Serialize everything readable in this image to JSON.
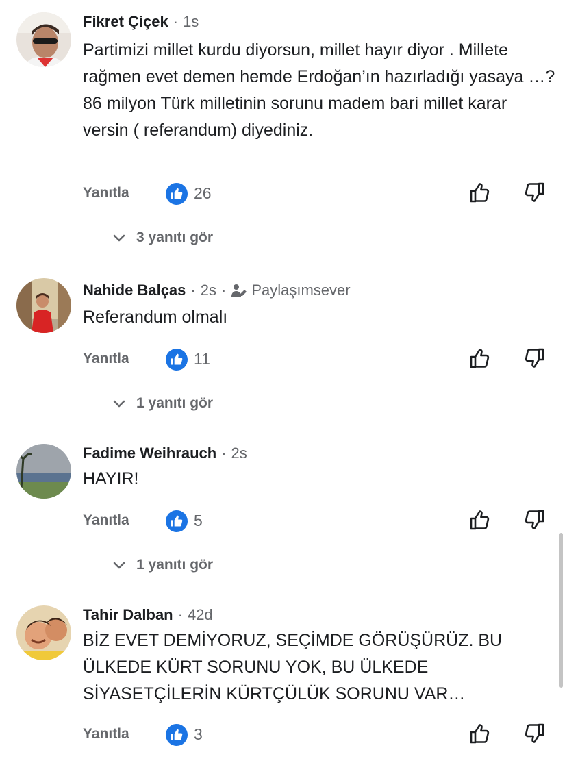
{
  "labels": {
    "reply": "Yanıtla"
  },
  "colors": {
    "like_badge": "#1b74e4",
    "secondary_text": "#65676b"
  },
  "comments": [
    {
      "author": "Fikret Çiçek",
      "time": "1s",
      "badge": "",
      "text": "Partimizi millet kurdu diyorsun, millet hayır diyor . Millete rağmen evet demen hemde Erdoğan’ın hazırladığı yasaya …? 86 milyon Türk milletinin sorunu madem bari millet karar versin ( referandum) diyediniz.",
      "likes": "26",
      "replies": "3 yanıtı gör"
    },
    {
      "author": "Nahide Balças",
      "time": "2s",
      "badge": "Paylaşımsever",
      "text": "Referandum olmalı",
      "likes": "11",
      "replies": "1 yanıtı gör"
    },
    {
      "author": "Fadime Weihrauch",
      "time": "2s",
      "badge": "",
      "text": "HAYIR!",
      "likes": "5",
      "replies": "1 yanıtı gör"
    },
    {
      "author": "Tahir Dalban",
      "time": "42d",
      "badge": "",
      "text": "BİZ EVET DEMİYORUZ, SEÇİMDE GÖRÜŞÜRÜZ. BU ÜLKEDE KÜRT SORUNU YOK, BU ÜLKEDE SİYASETÇİLERİN KÜRTÇÜLÜK SORUNU VAR…",
      "likes": "3",
      "replies": ""
    }
  ]
}
